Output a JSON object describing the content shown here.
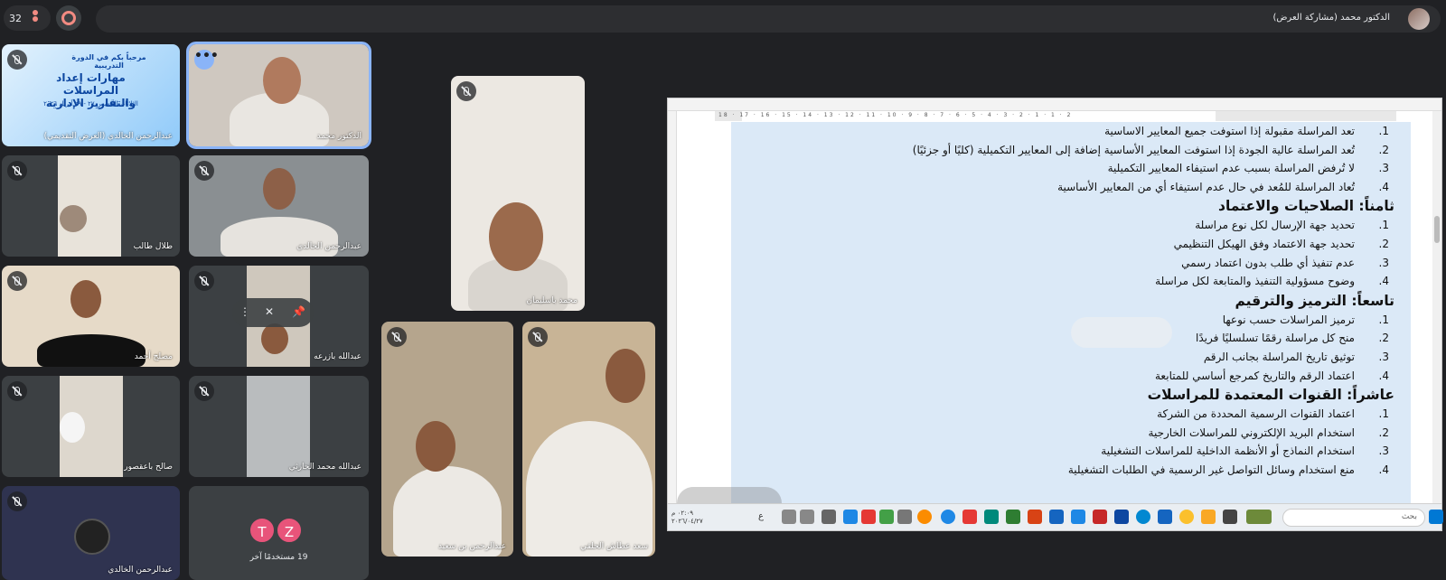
{
  "topbar": {
    "participant_count": "32",
    "presenter_label": "الدكتور محمد (مشاركة العرض)"
  },
  "tiles": {
    "banner": {
      "name": "عبدالرحمن الخالدي (العرض التقديمي)",
      "line1": "مرحباً بكم في الدورة التدريبية",
      "line2": "مهارات إعداد المراسلات والتقارير الإدارية",
      "line3": "الثلاثاء، الخميس ٢٧ - ٢٩ أبريل ٢٠٢٦"
    },
    "t2": {
      "name": "الدكتور محمد"
    },
    "t3": {
      "name": "طلال طالب"
    },
    "t4": {
      "name": "عبدالرحمن الخالدي"
    },
    "t5": {
      "name": "مصلح أحمد"
    },
    "t6": {
      "name": "عبدالله بازرعه"
    },
    "t7": {
      "name": "صالح باعقصور"
    },
    "t8": {
      "name": "عبدالله محمد الحارثي"
    },
    "t9": {
      "name": "عبدالرحمن الخالدي"
    },
    "t10": {
      "others_label": "19 مستخدمًا آخر",
      "avatar_t": "T",
      "avatar_z": "Z"
    },
    "center_top": {
      "name": "محمد باسليمان"
    },
    "center_left": {
      "name": "عبدالرحمن بن سعيد"
    },
    "center_right": {
      "name": "سعد عطاش الحلقي"
    }
  },
  "document": {
    "lines": [
      {
        "type": "item",
        "num": "1.",
        "text": "تعد المراسلة مقبولة إذا استوفت جميع المعايير الاساسية"
      },
      {
        "type": "item",
        "num": "2.",
        "text": "تُعد المراسلة عالية الجودة إذا استوفت المعايير الأساسية إضافة إلى المعايير التكميلية (كليًا أو جزئيًا)"
      },
      {
        "type": "item",
        "num": "3.",
        "text": "لا تُرفض المراسلة بسبب عدم استيفاء المعايير التكميلية"
      },
      {
        "type": "item",
        "num": "4.",
        "text": "تُعاد المراسلة للمُعد في حال عدم استيفاء أي من المعايير الأساسية"
      },
      {
        "type": "heading",
        "text": "ثامناً: الصلاحيات والاعتماد"
      },
      {
        "type": "item",
        "num": "1.",
        "text": "تحديد جهة الإرسال لكل نوع مراسلة"
      },
      {
        "type": "item",
        "num": "2.",
        "text": "تحديد جهة الاعتماد وفق الهيكل التنظيمي"
      },
      {
        "type": "item",
        "num": "3.",
        "text": "عدم تنفيذ أي طلب بدون اعتماد رسمي"
      },
      {
        "type": "item",
        "num": "4.",
        "text": "وضوح مسؤولية التنفيذ والمتابعة لكل مراسلة"
      },
      {
        "type": "heading",
        "text": "تاسعاً: الترميز والترقيم"
      },
      {
        "type": "item",
        "num": "1.",
        "text": "ترميز المراسلات حسب نوعها"
      },
      {
        "type": "item",
        "num": "2.",
        "text": "منح كل مراسلة رقمًا تسلسليًا فريدًا"
      },
      {
        "type": "item",
        "num": "3.",
        "text": "توثيق تاريخ المراسلة بجانب الرقم"
      },
      {
        "type": "item",
        "num": "4.",
        "text": "اعتماد الرقم والتاريخ كمرجع أساسي للمتابعة"
      },
      {
        "type": "heading",
        "text": "عاشراً: القنوات المعتمدة للمراسلات"
      },
      {
        "type": "item",
        "num": "1.",
        "text": "اعتماد القنوات الرسمية المحددة من الشركة"
      },
      {
        "type": "item",
        "num": "2.",
        "text": "استخدام البريد الإلكتروني للمراسلات الخارجية"
      },
      {
        "type": "item",
        "num": "3.",
        "text": "استخدام النماذج أو الأنظمة الداخلية للمراسلات التشغيلية"
      },
      {
        "type": "item",
        "num": "4.",
        "text": "منع استخدام وسائل التواصل غير الرسمية في الطلبات التشغيلية"
      }
    ]
  },
  "ruler": {
    "ticks": "18 · 17 · 16 · 15 · 14 · 13 · 12 · 11 · 10 · 9 · 8 · 7 · 6 · 5 · 4 · 3 · 2 · 1 · 1 · 2"
  },
  "taskbar": {
    "search_placeholder": "بحث",
    "time": "٠٢:٠٩ م",
    "date": "٢٠٢٦/٠٤/٢٧",
    "lang": "ع"
  },
  "colors": {
    "accent": "#8ab4f8",
    "background": "#202124",
    "tile": "#3c4043",
    "page": "#dbe9f7",
    "avatar_t": "#e8547a",
    "avatar_z": "#e8547a"
  }
}
